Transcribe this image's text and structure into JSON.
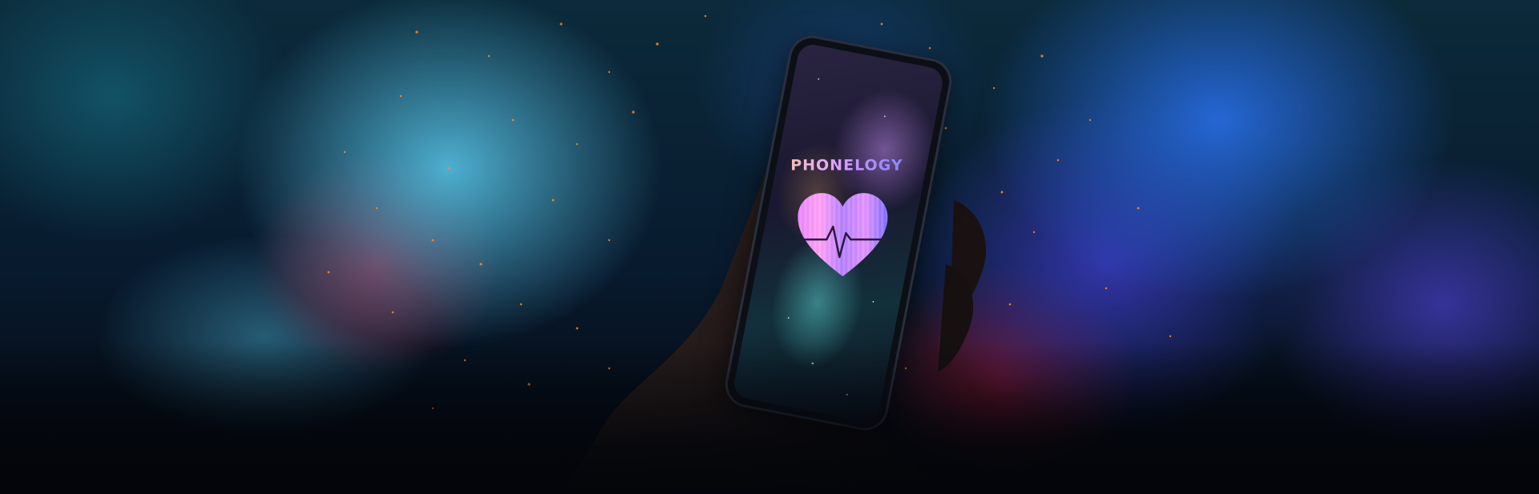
{
  "phone_screen": {
    "brand_text": "PHONELOGY"
  },
  "colors": {
    "ember": "#ff8a2a",
    "smoke_cyan": "#5ac8eb",
    "smoke_blue": "#2a6ee6",
    "smoke_red": "#961e3c",
    "heart_pink": "#e680ff",
    "heart_violet": "#9b6bff"
  },
  "icons": {
    "logo_mark": "heart-with-pulse-line"
  }
}
